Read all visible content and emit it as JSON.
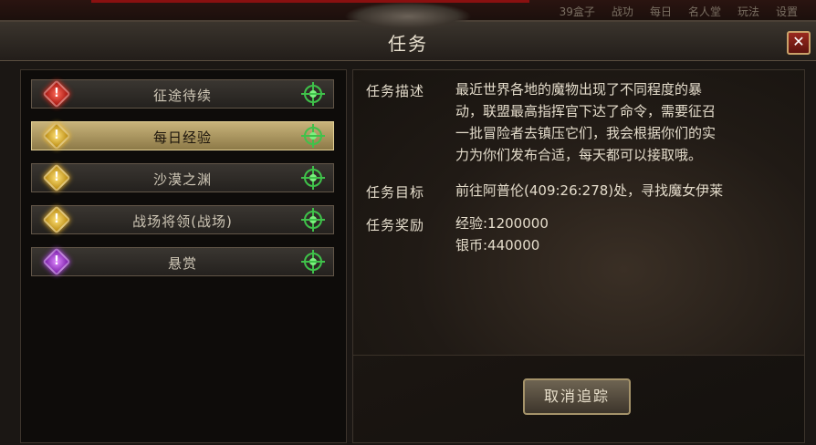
{
  "hud": {
    "menu": [
      "39盒子",
      "战功",
      "每日",
      "名人堂",
      "玩法",
      "设置"
    ]
  },
  "window": {
    "title": "任务",
    "close_label": "✕"
  },
  "quests": [
    {
      "label": "征途待续",
      "gem": "red",
      "active": false
    },
    {
      "label": "每日经验",
      "gem": "yellow",
      "active": true
    },
    {
      "label": "沙漠之渊",
      "gem": "yellow",
      "active": false
    },
    {
      "label": "战场将领(战场)",
      "gem": "yellow",
      "active": false
    },
    {
      "label": "悬赏",
      "gem": "purple",
      "active": false
    }
  ],
  "detail": {
    "desc_label": "任务描述",
    "desc_lines": [
      "最近世界各地的魔物出现了不同程度的暴",
      "动，联盟最高指挥官下达了命令，需要征召",
      "一批冒险者去镇压它们，我会根据你们的实",
      "力为你们发布合适，每天都可以接取哦。"
    ],
    "target_label": "任务目标",
    "target_text": "前往阿普伦(409:26:278)处，寻找魔女伊莱",
    "reward_label": "任务奖励",
    "reward_lines": [
      "经验:1200000",
      "银币:440000"
    ]
  },
  "cancel_button": "取消追踪",
  "colors": {
    "active_item": "#c8b37a",
    "target_icon": "#3fc24a"
  }
}
